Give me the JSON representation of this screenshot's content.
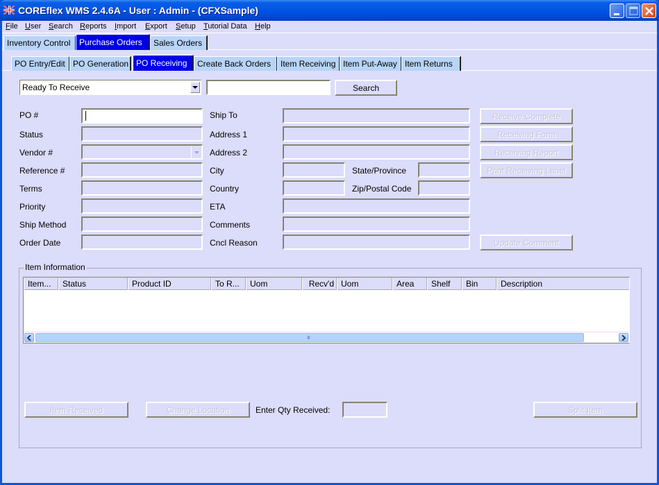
{
  "window": {
    "title": "COREflex WMS 2.4.6A - User : Admin - (CFXSample)",
    "controls": [
      "minimize",
      "maximize",
      "close"
    ]
  },
  "menu": [
    {
      "label": "File",
      "accel": "F",
      "rest": "ile"
    },
    {
      "label": "User",
      "accel": "U",
      "rest": "ser"
    },
    {
      "label": "Search",
      "accel": "S",
      "rest": "earch"
    },
    {
      "label": "Reports",
      "accel": "R",
      "rest": "eports"
    },
    {
      "label": "Import",
      "accel": "I",
      "rest": "mport"
    },
    {
      "label": "Export",
      "accel": "E",
      "rest": "xport"
    },
    {
      "label": "Setup",
      "accel": "S",
      "rest": "etup"
    },
    {
      "label": "Tutorial Data",
      "accel": "T",
      "rest": "utorial Data"
    },
    {
      "label": "Help",
      "accel": "H",
      "rest": "elp"
    }
  ],
  "main_tabs": [
    {
      "label": "Inventory Control",
      "active": false
    },
    {
      "label": "Purchase Orders",
      "active": true
    },
    {
      "label": "Sales Orders",
      "active": false
    }
  ],
  "sub_tabs": [
    {
      "label": "PO Entry/Edit",
      "active": false
    },
    {
      "label": "PO Generation",
      "active": false
    },
    {
      "label": "PO Receiving",
      "active": true
    },
    {
      "label": "Create Back Orders",
      "active": false
    },
    {
      "label": "Item Receiving",
      "active": false
    },
    {
      "label": "Item Put-Away",
      "active": false
    },
    {
      "label": "Item Returns",
      "active": false
    }
  ],
  "search": {
    "filter_value": "Ready To Receive",
    "query": "",
    "button": "Search"
  },
  "left_fields": {
    "po": {
      "label": "PO #",
      "value": ""
    },
    "status": {
      "label": "Status",
      "value": ""
    },
    "vendor": {
      "label": "Vendor #",
      "value": ""
    },
    "reference": {
      "label": "Reference #",
      "value": ""
    },
    "terms": {
      "label": "Terms",
      "value": ""
    },
    "priority": {
      "label": "Priority",
      "value": ""
    },
    "ship_method": {
      "label": "Ship Method",
      "value": ""
    },
    "order_date": {
      "label": "Order Date",
      "value": ""
    }
  },
  "right_fields": {
    "ship_to": {
      "label": "Ship To",
      "value": ""
    },
    "address1": {
      "label": "Address 1",
      "value": ""
    },
    "address2": {
      "label": "Address 2",
      "value": ""
    },
    "city": {
      "label": "City",
      "value": ""
    },
    "state": {
      "label": "State/Province",
      "value": ""
    },
    "country": {
      "label": "Country",
      "value": ""
    },
    "zip": {
      "label": "Zip/Postal Code",
      "value": ""
    },
    "eta": {
      "label": "ETA",
      "value": ""
    },
    "comments": {
      "label": "Comments",
      "value": ""
    },
    "cncl_reason": {
      "label": "Cncl Reason",
      "value": ""
    }
  },
  "actions": {
    "receive_complete": "Receive Complete",
    "receiving_form": "Receiving Form",
    "receiving_report": "Receiving Report",
    "print_label": "Print Receiving Label",
    "update_comment": "Update Comment"
  },
  "items": {
    "title": "Item Information",
    "columns": [
      "Item...",
      "Status",
      "Product ID",
      "To R...",
      "Uom",
      "Recv'd",
      "Uom",
      "Area",
      "Shelf",
      "Bin",
      "Description"
    ],
    "rows": [],
    "scroll_grip": "IIII"
  },
  "bottom": {
    "item_received": "Item Received",
    "change_location": "Change Location",
    "qty_label": "Enter Qty Received:",
    "qty_value": "",
    "split_item": "Split Item"
  },
  "colors": {
    "client_bg": "#dcdcfb",
    "active_tab": "#0000e8",
    "inactive_tab": "#b8d4f7",
    "titlebar": "#0055e5"
  }
}
